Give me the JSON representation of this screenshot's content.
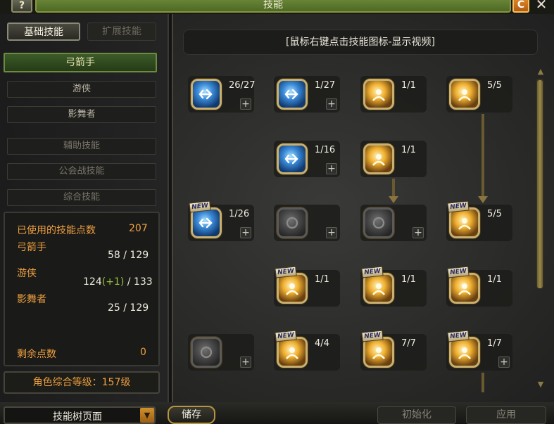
{
  "window": {
    "title": "技能",
    "help_label": "?",
    "refresh_label": "C",
    "close_label": "✕"
  },
  "tabs": {
    "basic": "基础技能",
    "extended": "扩展技能"
  },
  "classes": [
    {
      "label": "弓箭手",
      "state": "selected"
    },
    {
      "label": "游侠",
      "state": "normal"
    },
    {
      "label": "影舞者",
      "state": "normal"
    },
    {
      "label": "辅助技能",
      "state": "dim"
    },
    {
      "label": "公会战技能",
      "state": "dim"
    },
    {
      "label": "综合技能",
      "state": "dim"
    }
  ],
  "stats": {
    "used_label": "已使用的技能点数",
    "used_value": "207",
    "archer_label": "弓箭手",
    "archer_value": "58 / 129",
    "ranger_label": "游侠",
    "ranger_value_a": "124",
    "ranger_bonus": "(+1)",
    "ranger_value_b": "/ 133",
    "shadow_label": "影舞者",
    "shadow_value": "25 / 129",
    "remaining_label": "剩余点数",
    "remaining_value": "0"
  },
  "level_text": "角色综合等级：157级",
  "hint": "[鼠标右键点击技能图标-显示视频]",
  "bottom": {
    "page_select": "技能树页面",
    "save": "储存",
    "reset": "初始化",
    "apply": "应用"
  },
  "skills": [
    {
      "name": "skill-r1c1",
      "count": "26/27",
      "color": "blue",
      "new": false,
      "plus": true
    },
    {
      "name": "skill-r1c2",
      "count": "1/27",
      "color": "blue",
      "new": false,
      "plus": true
    },
    {
      "name": "skill-r1c3",
      "count": "1/1",
      "color": "gold",
      "new": false,
      "plus": false
    },
    {
      "name": "skill-r1c4",
      "count": "5/5",
      "color": "gold",
      "new": false,
      "plus": false
    },
    {
      "name": "skill-r2c2",
      "count": "1/16",
      "color": "blue",
      "new": false,
      "plus": true
    },
    {
      "name": "skill-r2c3",
      "count": "1/1",
      "color": "gold",
      "new": false,
      "plus": false
    },
    {
      "name": "skill-r3c1",
      "count": "1/26",
      "color": "blue",
      "new": true,
      "plus": true
    },
    {
      "name": "skill-r3c2",
      "count": "",
      "color": "gray",
      "new": false,
      "plus": true
    },
    {
      "name": "skill-r3c3",
      "count": "",
      "color": "gray",
      "new": false,
      "plus": true
    },
    {
      "name": "skill-r3c4",
      "count": "5/5",
      "color": "gold",
      "new": true,
      "plus": false
    },
    {
      "name": "skill-r4c2",
      "count": "1/1",
      "color": "gold",
      "new": true,
      "plus": false
    },
    {
      "name": "skill-r4c3",
      "count": "1/1",
      "color": "gold",
      "new": true,
      "plus": false
    },
    {
      "name": "skill-r4c4",
      "count": "1/1",
      "color": "gold",
      "new": true,
      "plus": false
    },
    {
      "name": "skill-r5c1",
      "count": "",
      "color": "gray",
      "new": false,
      "plus": true
    },
    {
      "name": "skill-r5c2",
      "count": "4/4",
      "color": "gold",
      "new": true,
      "plus": false
    },
    {
      "name": "skill-r5c3",
      "count": "7/7",
      "color": "gold",
      "new": true,
      "plus": false
    },
    {
      "name": "skill-r5c4",
      "count": "1/7",
      "color": "gold",
      "new": true,
      "plus": true
    }
  ],
  "new_badge": "NEW",
  "colors": {
    "accent_orange": "#f0a040",
    "bonus_green": "#9ac040",
    "title_green": "#5a7a2e"
  }
}
